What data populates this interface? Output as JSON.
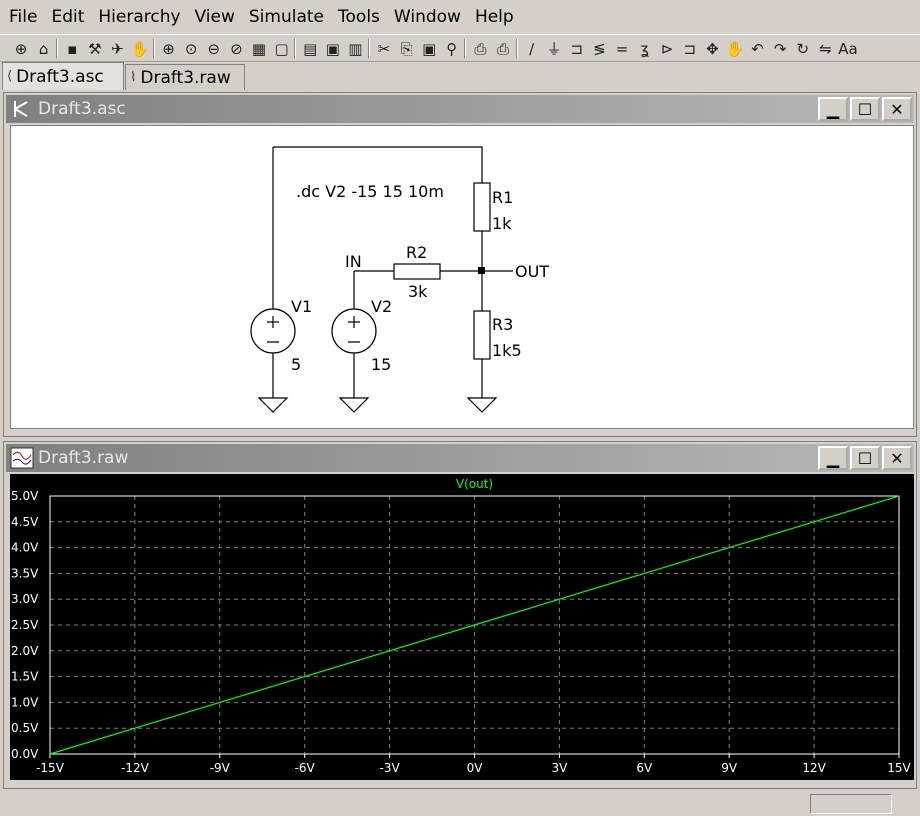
{
  "menu": [
    "File",
    "Edit",
    "Hierarchy",
    "View",
    "Simulate",
    "Tools",
    "Window",
    "Help"
  ],
  "toolbar_icons": [
    "new-schematic-icon",
    "open-folder-icon",
    "save-icon",
    "control-panel-icon",
    "run-icon",
    "halt-icon",
    "zoom-in-icon",
    "zoom-pan-icon",
    "zoom-out-icon",
    "zoom-cancel-icon",
    "autorange-icon",
    "fit-icon",
    "tile-horizontal-icon",
    "cascade-icon",
    "tile-vertical-icon",
    "cut-icon",
    "copy-icon",
    "paste-icon",
    "find-icon",
    "print-preview-icon",
    "print-icon",
    "wire-icon",
    "ground-icon",
    "label-net-icon",
    "resistor-icon",
    "capacitor-icon",
    "inductor-icon",
    "diode-icon",
    "component-icon",
    "move-icon",
    "drag-icon",
    "undo-icon",
    "redo-icon",
    "rotate-icon",
    "mirror-icon",
    "text-icon"
  ],
  "toolbar_glyphs": [
    "⊕",
    "⌂",
    "▪",
    "⚒",
    "✈",
    "✋",
    "⊕",
    "⊙",
    "⊖",
    "⊘",
    "▦",
    "▢",
    "▤",
    "▣",
    "▥",
    "✂",
    "⎘",
    "▣",
    "⚲",
    "⎙",
    "⎙",
    "∕",
    "⏚",
    "⊐",
    "≶",
    "=",
    "ʓ",
    "⊳",
    "⊐",
    "✥",
    "✋",
    "↶",
    "↷",
    "↻",
    "⇋",
    "Aa"
  ],
  "tabs": [
    {
      "label": "Draft3.asc",
      "icon": "schematic-icon",
      "glyph": "⟨"
    },
    {
      "label": "Draft3.raw",
      "icon": "waveform-icon",
      "glyph": "⌇"
    }
  ],
  "schematic_window": {
    "title": "Draft3.asc",
    "directive": ".dc V2 -15 15 10m",
    "components": {
      "r1_name": "R1",
      "r1_value": "1k",
      "r2_name": "R2",
      "r2_value": "3k",
      "r3_name": "R3",
      "r3_value": "1k5",
      "v1_name": "V1",
      "v1_value": "5",
      "v2_name": "V2",
      "v2_value": "15"
    },
    "nets": {
      "in": "IN",
      "out": "OUT"
    }
  },
  "waveform_window": {
    "title": "Draft3.raw",
    "buttons": {
      "minimize": "▁",
      "maximize": "☐",
      "close": "✕"
    }
  },
  "window_buttons": {
    "minimize": "▁",
    "maximize": "☐",
    "close": "✕"
  },
  "colors": {
    "trace": "#00ff00",
    "plot_bg": "#000000",
    "grid": "#808080",
    "axis_text": "#ffffff"
  },
  "chart_data": {
    "type": "line",
    "title": "V(out)",
    "xlabel": "",
    "ylabel": "",
    "xlim": [
      -15,
      15
    ],
    "ylim": [
      0,
      5
    ],
    "x_ticks": [
      "-15V",
      "-12V",
      "-9V",
      "-6V",
      "-3V",
      "0V",
      "3V",
      "6V",
      "9V",
      "12V",
      "15V"
    ],
    "y_ticks": [
      "0.0V",
      "0.5V",
      "1.0V",
      "1.5V",
      "2.0V",
      "2.5V",
      "3.0V",
      "3.5V",
      "4.0V",
      "4.5V",
      "5.0V"
    ],
    "grid": true,
    "series": [
      {
        "name": "V(out)",
        "x": [
          -15,
          -12,
          -9,
          -6,
          -3,
          0,
          3,
          6,
          9,
          12,
          15
        ],
        "y": [
          0.0,
          0.5,
          1.0,
          1.5,
          2.0,
          2.5,
          3.0,
          3.5,
          4.0,
          4.5,
          5.0
        ]
      }
    ]
  }
}
